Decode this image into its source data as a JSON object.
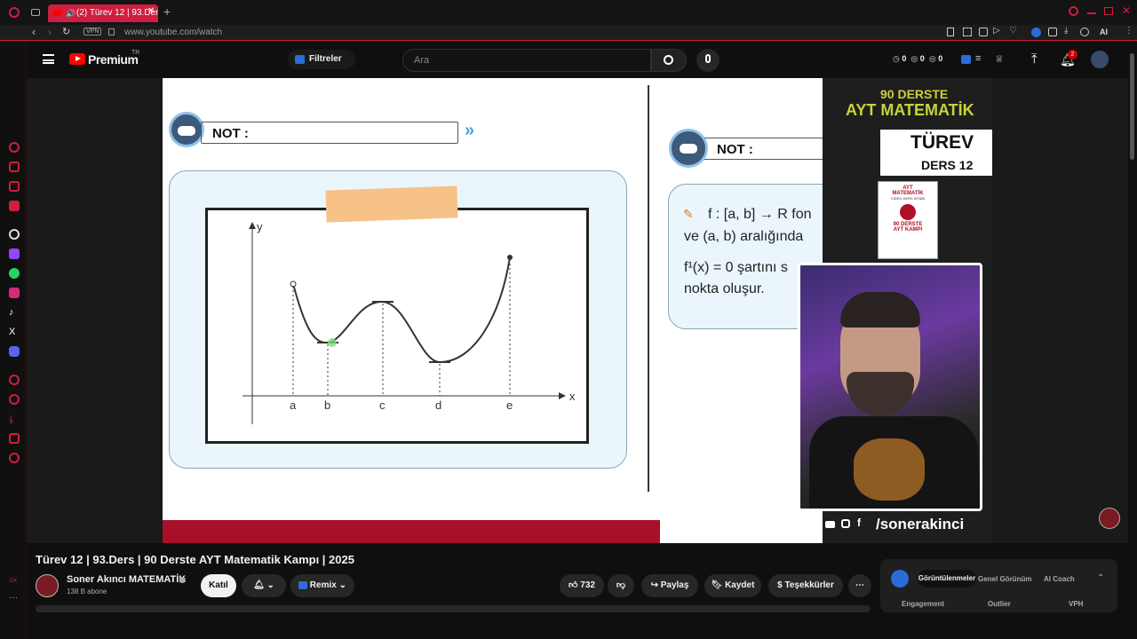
{
  "browser": {
    "tab_title": "(2) Türev 12 | 93.Ders",
    "url": "www.youtube.com/watch",
    "vpn_label": "VPN",
    "ai_label": "AI"
  },
  "youtube": {
    "logo": "Premium",
    "logo_badge": "TR",
    "filter_label": "Filtreler",
    "search_placeholder": "Ara",
    "stats": [
      "0",
      "0",
      "0"
    ],
    "notification_count": "2"
  },
  "slide": {
    "note_label_left": "NOT :",
    "note_label_right": "NOT :",
    "graph_y": "y",
    "graph_x": "x",
    "graph_points": [
      "a",
      "b",
      "c",
      "d",
      "e"
    ],
    "text_line1": "f : [a, b] → R fon",
    "text_line2": "ve (a, b) aralığında",
    "text_line3": "f¹(x) = 0 şartını s",
    "text_line4": "nokta oluşur.",
    "promo_title_1": "90 DERSTE",
    "promo_title_2": "AYT MATEMATİK",
    "promo_topic": "TÜREV",
    "promo_lesson": "DERS 12",
    "book_line1": "AYT",
    "book_line2": "MATEMATİK",
    "book_line3": "VİDEO DERS KİTABI",
    "book_line4": "90 DERSTE",
    "book_line5": "AYT KAMPI",
    "social_handle": "/sonerakinci"
  },
  "video_info": {
    "title": "Türev 12 | 93.Ders | 90 Derste AYT Matematik Kampı | 2025",
    "channel": "Soner Akıncı MATEMATİK",
    "subscribers": "138 B abone",
    "join_label": "Katıl",
    "remix_label": "Remix",
    "likes": "732",
    "share_label": "Paylaş",
    "save_label": "Kaydet",
    "thanks_label": "Teşekkürler"
  },
  "iq_panel": {
    "tabs": [
      "Görüntülenmeler",
      "Genel Görünüm",
      "AI Coach"
    ],
    "headers": [
      "Engagement",
      "Outlier",
      "VPH"
    ]
  },
  "colors": {
    "accent_red": "#cf1e3f",
    "youtube_red": "#ff0000",
    "promo_green": "#c8d23a"
  }
}
